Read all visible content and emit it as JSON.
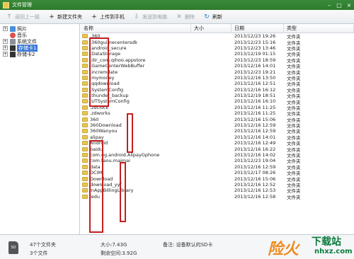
{
  "window": {
    "title": "文件管理",
    "min_glyph": "–",
    "max_glyph": "□",
    "close_glyph": "×"
  },
  "toolbar": {
    "back": "返回上一级",
    "new_folder": "新建文件夹",
    "upload": "上传到手机",
    "send": "发送到电脑",
    "delete": "删除",
    "refresh": "刷新"
  },
  "tree": [
    {
      "label": "照片",
      "expander": "+",
      "selected": false
    },
    {
      "label": "音乐",
      "expander": "",
      "selected": false
    },
    {
      "label": "系统文件",
      "expander": "+",
      "selected": false
    },
    {
      "label": "存储卡1",
      "expander": "+",
      "selected": true
    },
    {
      "label": "存储卡2",
      "expander": "+",
      "selected": false
    }
  ],
  "columns": {
    "name": "名称",
    "size": "大小",
    "date": "日期",
    "type": "类型"
  },
  "files": [
    {
      "name": ".360",
      "date": "2013/12/23 19:26",
      "type": "文件夹"
    },
    {
      "name": ".360guimecentersdk",
      "date": "2013/12/23 15:16",
      "type": "文件夹"
    },
    {
      "name": ".android_secure",
      "date": "2013/12/23 13:46",
      "type": "文件夹"
    },
    {
      "name": ".DataStorage",
      "date": "2013/12/19 01:15",
      "type": "文件夹"
    },
    {
      "name": ".dir_com.qihoo.appstore",
      "date": "2013/12/23 18:59",
      "type": "文件夹"
    },
    {
      "name": ".GameCenterWebBuffer",
      "date": "2013/12/16 14:01",
      "type": "文件夹"
    },
    {
      "name": ".incremdate",
      "date": "2013/12/23 19:21",
      "type": "文件夹"
    },
    {
      "name": ".mymoney",
      "date": "2013/12/16 13:50",
      "type": "文件夹"
    },
    {
      "name": ".qqdownload",
      "date": "2013/12/16 12:51",
      "type": "文件夹"
    },
    {
      "name": ".SystemConfig",
      "date": "2013/12/16 16:12",
      "type": "文件夹"
    },
    {
      "name": ".thunder_backup",
      "date": "2013/12/19 18:51",
      "type": "文件夹"
    },
    {
      "name": ".UTSystemConfig",
      "date": "2013/12/16 16:10",
      "type": "文件夹"
    },
    {
      "name": ".zdclock",
      "date": "2013/12/16 11:25",
      "type": "文件夹"
    },
    {
      "name": ".zdworks",
      "date": "2013/12/16 11:25",
      "type": "文件夹"
    },
    {
      "name": "360",
      "date": "2013/12/16 15:06",
      "type": "文件夹"
    },
    {
      "name": "360Download",
      "date": "2013/12/16 12:59",
      "type": "文件夹"
    },
    {
      "name": "360Wanyou",
      "date": "2013/12/16 12:59",
      "type": "文件夹"
    },
    {
      "name": "alipay",
      "date": "2013/12/16 14:01",
      "type": "文件夹"
    },
    {
      "name": "Android",
      "date": "2013/12/16 12:49",
      "type": "文件夹"
    },
    {
      "name": "baidu",
      "date": "2013/12/16 16:22",
      "type": "文件夹"
    },
    {
      "name": "com.eg.android.AlipayGphone",
      "date": "2013/12/16 14:02",
      "type": "文件夹"
    },
    {
      "name": "com.taou.maimai",
      "date": "2013/12/23 19:04",
      "type": "文件夹"
    },
    {
      "name": "data",
      "date": "2013/12/16 12:59",
      "type": "文件夹"
    },
    {
      "name": "DCIM",
      "date": "2013/12/17 08:26",
      "type": "文件夹"
    },
    {
      "name": "Download",
      "date": "2013/12/16 15:06",
      "type": "文件夹"
    },
    {
      "name": "download_yyf",
      "date": "2013/12/16 12:52",
      "type": "文件夹"
    },
    {
      "name": "InAppBillingLibrary",
      "date": "2013/12/16 12:53",
      "type": "文件夹"
    },
    {
      "name": "ledu",
      "date": "2013/12/16 12:58",
      "type": "文件夹"
    }
  ],
  "status": {
    "sd_label": "SD",
    "folders": "47个文件夹",
    "files": "3个文件",
    "size": "大小:7.43G",
    "free": "剩余空间:3.92G",
    "note": "备注: 设备默认的SD卡"
  },
  "watermark": {
    "logo": "险火",
    "site": "下载站",
    "url": "nhxz.com"
  }
}
